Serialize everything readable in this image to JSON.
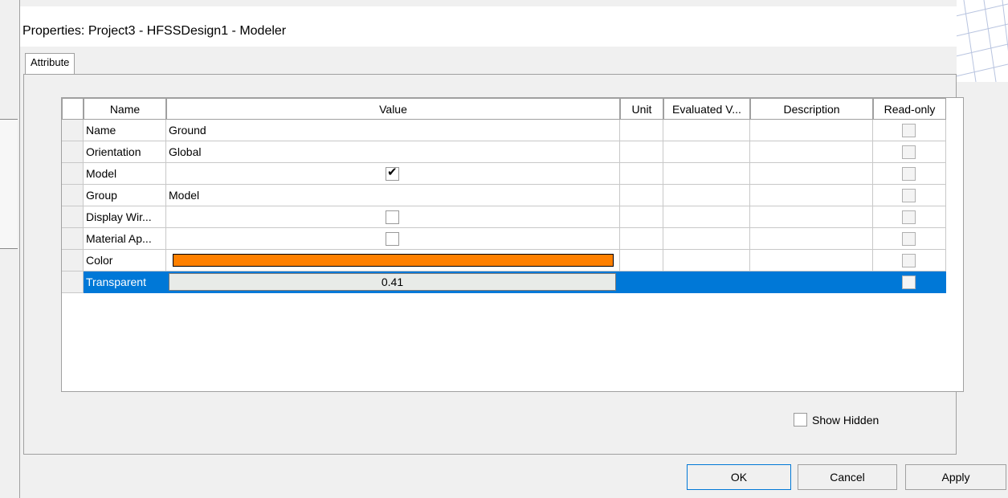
{
  "dialog": {
    "title": "Properties: Project3 - HFSSDesign1 - Modeler",
    "tab_label": "Attribute"
  },
  "table": {
    "headers": [
      "Name",
      "Value",
      "Unit",
      "Evaluated V...",
      "Description",
      "Read-only"
    ],
    "rows": [
      {
        "name": "Name",
        "value": "Ground"
      },
      {
        "name": "Orientation",
        "value": "Global"
      },
      {
        "name": "Model",
        "value": ""
      },
      {
        "name": "Group",
        "value": "Model"
      },
      {
        "name": "Display Wir...",
        "value": ""
      },
      {
        "name": "Material Ap...",
        "value": ""
      },
      {
        "name": "Color",
        "value": ""
      },
      {
        "name": "Transparent",
        "value": "0.41"
      }
    ],
    "model_checked": true,
    "display_wireframe_checked": false,
    "material_appearance_checked": false,
    "color_swatch": "#ff8000",
    "selected_row_color": "#0078d7"
  },
  "show_hidden": {
    "label": "Show Hidden",
    "checked": false
  },
  "buttons": {
    "ok": "OK",
    "cancel": "Cancel",
    "apply": "Apply"
  }
}
